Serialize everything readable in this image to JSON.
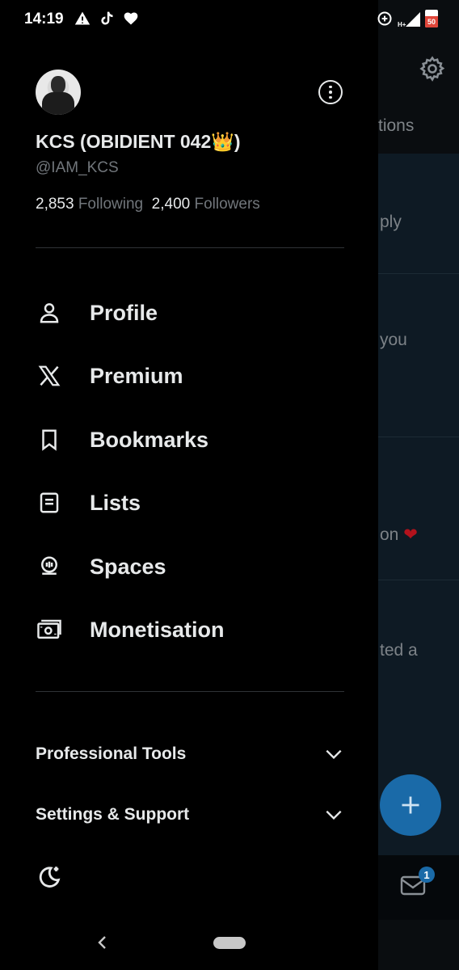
{
  "status_bar": {
    "time": "14:19",
    "icons": [
      "warning-icon",
      "tiktok-icon",
      "heart-icon",
      "data-saver-icon",
      "signal-icon",
      "battery-icon"
    ],
    "battery": "50"
  },
  "background_app": {
    "tab_fragment": "tions",
    "row_fragments": [
      "ply",
      "you",
      "on",
      "ted a"
    ],
    "heart_color": "#b3121c",
    "fab_color": "#1a6aa8",
    "messages_badge": "1"
  },
  "drawer": {
    "profile": {
      "display_name": "KCS (OBIDIENT 042👑)",
      "handle": "@IAM_KCS",
      "following_count": "2,853",
      "following_label": "Following",
      "followers_count": "2,400",
      "followers_label": "Followers"
    },
    "menu": [
      {
        "label": "Profile",
        "icon": "person-icon"
      },
      {
        "label": "Premium",
        "icon": "x-logo-icon"
      },
      {
        "label": "Bookmarks",
        "icon": "bookmark-icon"
      },
      {
        "label": "Lists",
        "icon": "list-icon"
      },
      {
        "label": "Spaces",
        "icon": "spaces-icon"
      },
      {
        "label": "Monetisation",
        "icon": "money-icon"
      }
    ],
    "sections": [
      {
        "label": "Professional Tools",
        "icon": "chevron-down-icon"
      },
      {
        "label": "Settings & Support",
        "icon": "chevron-down-icon"
      }
    ],
    "theme_toggle_icon": "moon-icon"
  },
  "colors": {
    "text_primary": "#e7e9ea",
    "text_secondary": "#71767b",
    "divider": "#2f3336",
    "accent": "#1d9bf0"
  }
}
